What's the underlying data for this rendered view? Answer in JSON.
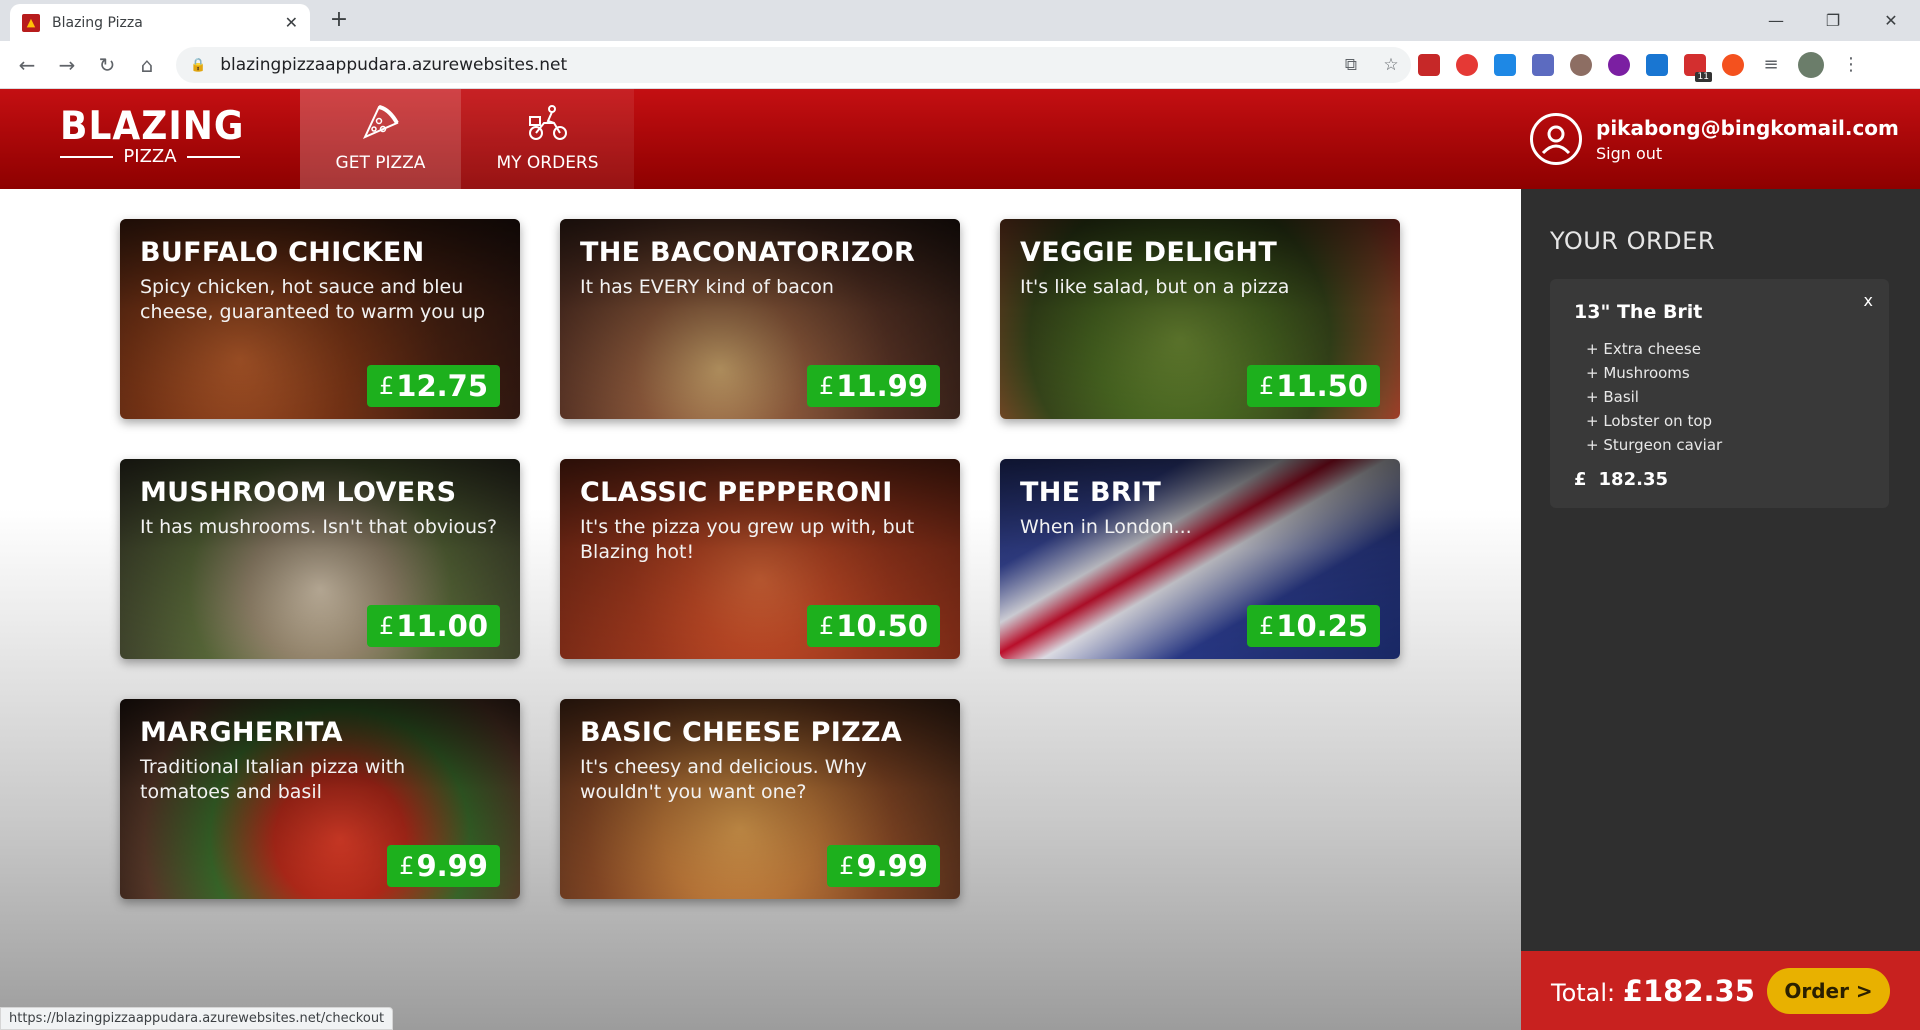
{
  "browser": {
    "tab_title": "Blazing Pizza",
    "url": "blazingpizzaappudara.azurewebsites.net",
    "status_url": "https://blazingpizzaappudara.azurewebsites.net/checkout",
    "extension_badge": "11"
  },
  "header": {
    "logo_main": "BLAZING",
    "logo_sub": "PIZZA",
    "nav": [
      {
        "label": "GET PIZZA",
        "icon": "pizza-slice-icon",
        "active": true
      },
      {
        "label": "MY ORDERS",
        "icon": "delivery-bike-icon",
        "active": false
      }
    ],
    "user_email": "pikabong@bingkomail.com",
    "sign_out": "Sign out"
  },
  "specials": [
    {
      "title": "BUFFALO CHICKEN",
      "desc": "Spicy chicken, hot sauce and bleu cheese, guaranteed to warm you up",
      "currency": "£",
      "price": "12.75"
    },
    {
      "title": "THE BACONATORIZOR",
      "desc": "It has EVERY kind of bacon",
      "currency": "£",
      "price": "11.99"
    },
    {
      "title": "VEGGIE DELIGHT",
      "desc": "It's like salad, but on a pizza",
      "currency": "£",
      "price": "11.50"
    },
    {
      "title": "MUSHROOM LOVERS",
      "desc": "It has mushrooms. Isn't that obvious?",
      "currency": "£",
      "price": "11.00"
    },
    {
      "title": "CLASSIC PEPPERONI",
      "desc": "It's the pizza you grew up with, but Blazing hot!",
      "currency": "£",
      "price": "10.50"
    },
    {
      "title": "THE BRIT",
      "desc": "When in London...",
      "currency": "£",
      "price": "10.25"
    },
    {
      "title": "MARGHERITA",
      "desc": "Traditional Italian pizza with tomatoes and basil",
      "currency": "£",
      "price": "9.99"
    },
    {
      "title": "BASIC CHEESE PIZZA",
      "desc": "It's cheesy and delicious. Why wouldn't you want one?",
      "currency": "£",
      "price": "9.99"
    }
  ],
  "order": {
    "heading": "YOUR ORDER",
    "item": {
      "title": "13\" The Brit",
      "close": "x",
      "toppings": [
        "+ Extra cheese",
        "+ Mushrooms",
        "+ Basil",
        "+ Lobster on top",
        "+ Sturgeon caviar"
      ],
      "currency": "£",
      "price": "182.35"
    },
    "total_label": "Total:",
    "total_value": "£182.35",
    "order_button": "Order >"
  },
  "colors": {
    "header_red": "#c40f12",
    "price_green": "#1db01d",
    "sidebar_dark": "#2f2f2f",
    "order_button": "#e8b100"
  }
}
